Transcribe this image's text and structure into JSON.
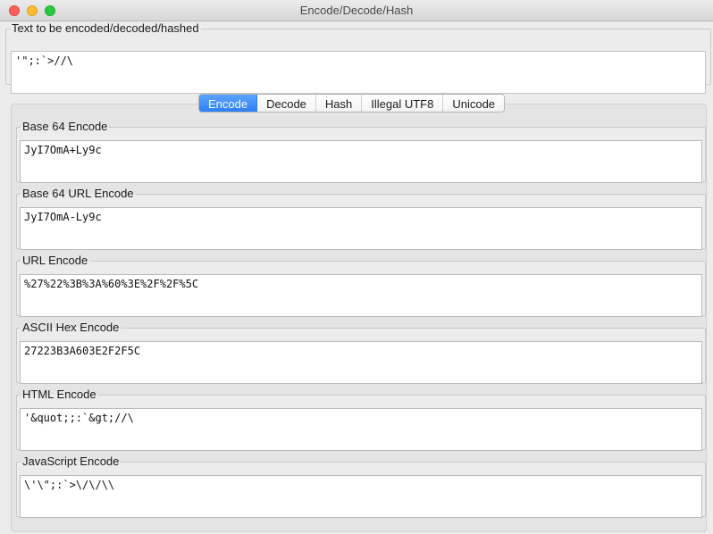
{
  "window": {
    "title": "Encode/Decode/Hash"
  },
  "input": {
    "legend": "Text to be encoded/decoded/hashed",
    "value": "'\";:`>//\\"
  },
  "tabs": [
    {
      "label": "Encode",
      "active": true
    },
    {
      "label": "Decode",
      "active": false
    },
    {
      "label": "Hash",
      "active": false
    },
    {
      "label": "Illegal UTF8",
      "active": false
    },
    {
      "label": "Unicode",
      "active": false
    }
  ],
  "encodings": {
    "base64": {
      "legend": "Base 64 Encode",
      "value": "JyI7OmA+Ly9c"
    },
    "base64url": {
      "legend": "Base 64 URL Encode",
      "value": "JyI7OmA-Ly9c"
    },
    "url": {
      "legend": "URL Encode",
      "value": "%27%22%3B%3A%60%3E%2F%2F%5C"
    },
    "asciihex": {
      "legend": "ASCII Hex Encode",
      "value": "27223B3A603E2F2F5C"
    },
    "html": {
      "legend": "HTML Encode",
      "value": "'&quot;;:`&gt;//\\"
    },
    "javascript": {
      "legend": "JavaScript Encode",
      "value": "\\'\\\";:`>\\/\\/\\\\"
    }
  },
  "colors": {
    "accent": "#2f7ff5",
    "close": "#fc5f57",
    "minimize": "#fdbc2e",
    "maximize": "#28c840"
  }
}
